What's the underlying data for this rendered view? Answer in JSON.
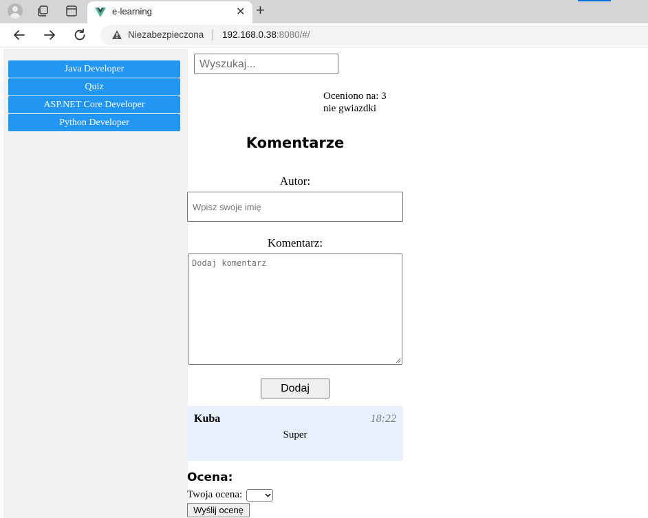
{
  "browser": {
    "tab_title": "e-learning",
    "tab_close": "✕",
    "new_tab": "+",
    "security_label": "Niezabezpieczona",
    "url_host": "192.168.0.38",
    "url_rest": ":8080/#/",
    "accent_color": "#0b6cdc"
  },
  "sidebar": {
    "items": [
      {
        "label": "Java Developer"
      },
      {
        "label": "Quiz"
      },
      {
        "label": "ASP.NET Core Developer"
      },
      {
        "label": "Python Developer"
      }
    ],
    "item_color": "#2196f3"
  },
  "search": {
    "placeholder": "Wyszukaj..."
  },
  "rating_info": {
    "line1": "Oceniono na: 3",
    "line2": "nie gwiazdki"
  },
  "comments": {
    "title": "Komentarze",
    "author_label": "Autor:",
    "author_placeholder": "Wpisz swoje imię",
    "comment_label": "Komentarz:",
    "comment_placeholder": "Dodaj komentarz",
    "add_button": "Dodaj",
    "list": [
      {
        "author": "Kuba",
        "time": "18:22",
        "text": "Super"
      }
    ],
    "card_color": "#e8f0fe"
  },
  "rating": {
    "title": "Ocena:",
    "your_rating_label": "Twoja ocena:",
    "select_value": "",
    "send_button": "Wyślij ocenę"
  }
}
